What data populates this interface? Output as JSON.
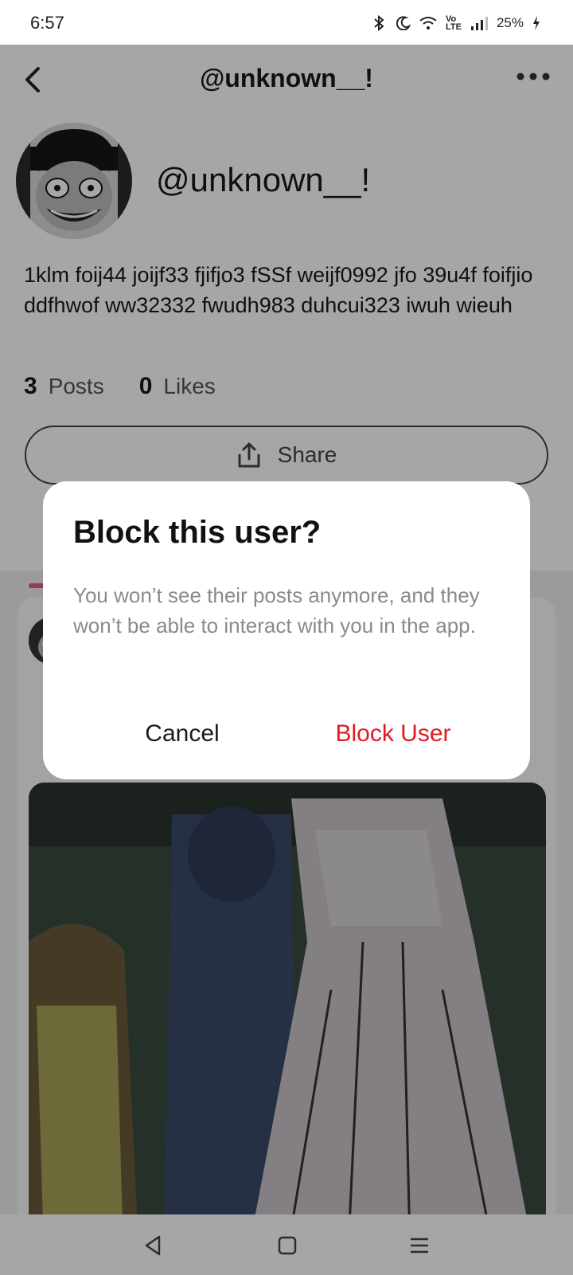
{
  "status_bar": {
    "time": "6:57",
    "battery": "25%"
  },
  "header": {
    "title": "@unknown__!"
  },
  "profile": {
    "handle": "@unknown__!",
    "bio": "1klm foij44 joijf33 fjifjo3 fSSf weijf0992 jfo 39u4f foifjio ddfhwof ww32332 fwudh983 duhcui323 iwuh wieuh",
    "posts_count": "3",
    "posts_label": "Posts",
    "likes_count": "0",
    "likes_label": "Likes",
    "share_label": "Share"
  },
  "dialog": {
    "title": "Block this user?",
    "body": "You won’t see their posts anymore, and they won’t be able to interact with you in the app.",
    "cancel_label": "Cancel",
    "confirm_label": "Block User"
  },
  "colors": {
    "accent_pink": "#e85a7e",
    "destructive": "#e01b24"
  },
  "icons": [
    "back-chevron-icon",
    "more-horizontal-icon",
    "share-upload-icon",
    "nav-back-icon",
    "nav-home-icon",
    "nav-menu-icon"
  ]
}
